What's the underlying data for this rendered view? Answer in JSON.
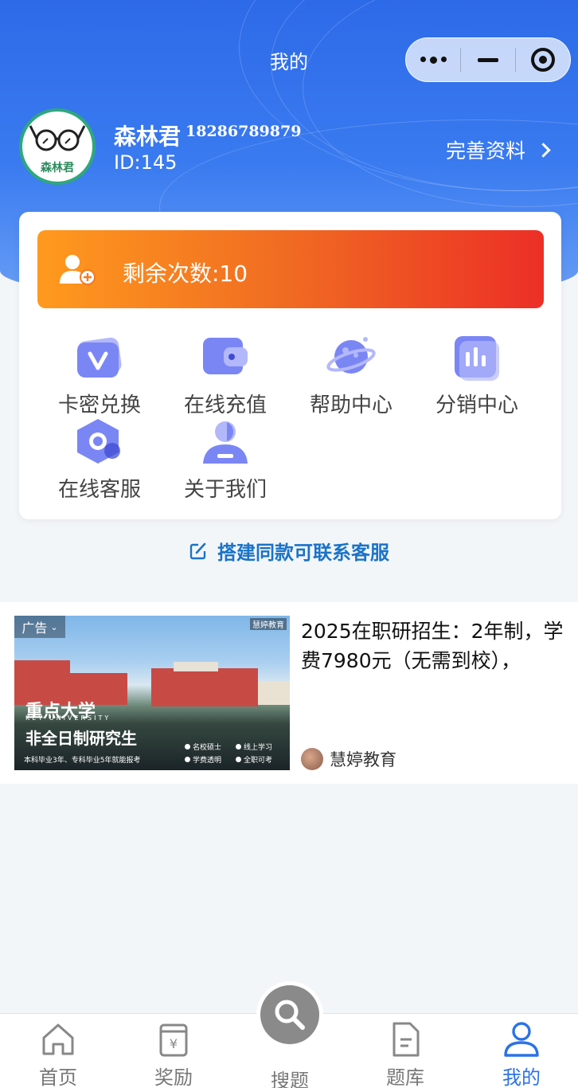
{
  "nav": {
    "title": "我的"
  },
  "profile": {
    "name": "森林君",
    "phone": "18286789879",
    "id_text": "ID:145",
    "avatar_brand": "森林君",
    "edit_label": "完善资料"
  },
  "quota": {
    "text": "剩余次数:10"
  },
  "menu": [
    {
      "label": "卡密兑换",
      "icon": "voucher-v-icon"
    },
    {
      "label": "在线充值",
      "icon": "wallet-icon"
    },
    {
      "label": "帮助中心",
      "icon": "planet-icon"
    },
    {
      "label": "分销中心",
      "icon": "bar-chart-icon"
    },
    {
      "label": "在线客服",
      "icon": "customer-service-icon"
    },
    {
      "label": "关于我们",
      "icon": "person-icon"
    }
  ],
  "contact": {
    "text": "搭建同款可联系客服"
  },
  "ad": {
    "tag": "广告",
    "corner": "慧婷教育",
    "university": "重点大学",
    "university_en": "KEY UNIVERSITY",
    "program": "非全日制研究生",
    "note": "本科毕业3年、专科毕业5年就能报考",
    "features": [
      "名校硕士",
      "线上学习",
      "学费透明",
      "全职可考"
    ],
    "title": "2025在职研招生：2年制，学费7980元（无需到校），",
    "source": "慧婷教育"
  },
  "tabs": [
    {
      "label": "首页",
      "icon": "home-icon"
    },
    {
      "label": "奖励",
      "icon": "reward-icon"
    },
    {
      "label": "搜题",
      "icon": "search-icon"
    },
    {
      "label": "题库",
      "icon": "document-icon"
    },
    {
      "label": "我的",
      "icon": "user-icon",
      "active": true
    }
  ],
  "colors": {
    "primary": "#2d6ae8",
    "quota_start": "#ff9a1e",
    "quota_end": "#ec2f26",
    "icon": "#7b86f5",
    "link": "#1a73c8"
  }
}
